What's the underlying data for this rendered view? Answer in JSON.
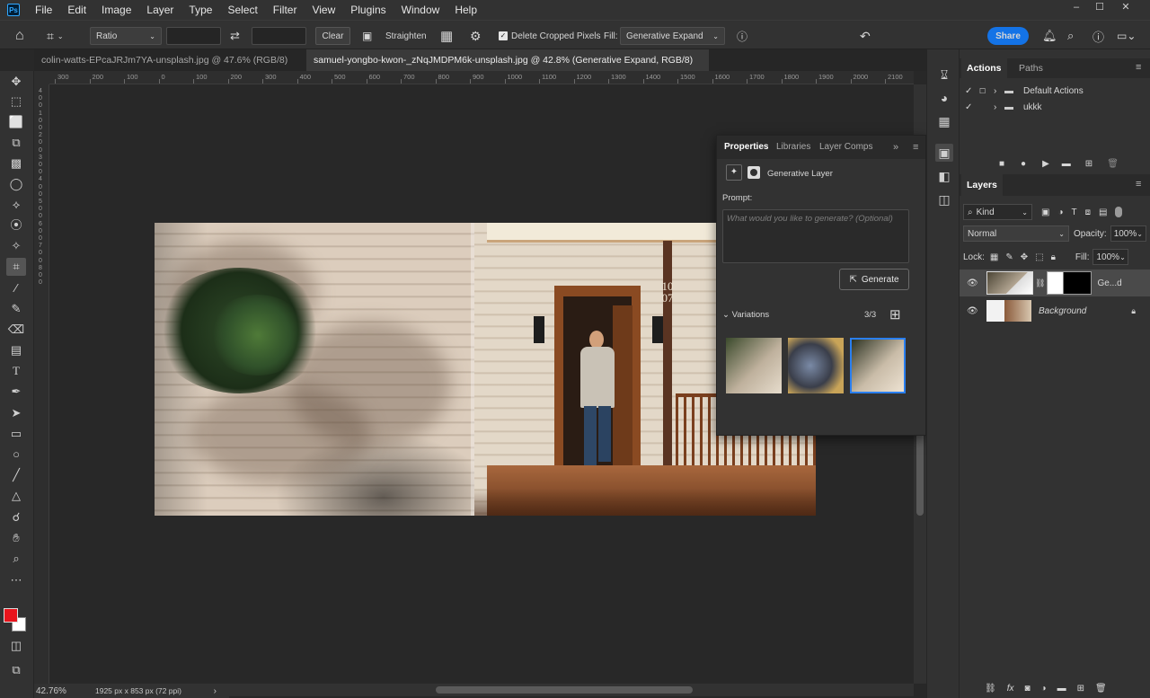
{
  "app": {
    "logo": "Ps"
  },
  "menu": [
    "File",
    "Edit",
    "Image",
    "Layer",
    "Type",
    "Select",
    "Filter",
    "View",
    "Plugins",
    "Window",
    "Help"
  ],
  "window_controls": [
    "‒",
    "☐",
    "✕"
  ],
  "options": {
    "ratio": "Ratio",
    "clear": "Clear",
    "straighten": "Straighten",
    "delete_cropped": "Delete Cropped Pixels",
    "fill_label": "Fill:",
    "fill_value": "Generative Expand",
    "share": "Share"
  },
  "tabs": [
    {
      "label": "colin-watts-EPcaJRJm7YA-unsplash.jpg @ 47.6% (RGB/8) *"
    },
    {
      "label": "samuel-yongbo-kwon-_zNqJMDPM6k-unsplash.jpg @ 42.8% (Generative Expand, RGB/8) *"
    }
  ],
  "ruler_h": [
    "300",
    "200",
    "100",
    "0",
    "100",
    "200",
    "300",
    "400",
    "500",
    "600",
    "700",
    "800",
    "900",
    "1000",
    "1100",
    "1200",
    "1300",
    "1400",
    "1500",
    "1600",
    "1700",
    "1800",
    "1900",
    "2000",
    "2100"
  ],
  "ruler_v": [
    "4",
    "0",
    "0",
    "1",
    "0",
    "0",
    "2",
    "0",
    "0",
    "3",
    "0",
    "0",
    "4",
    "0",
    "0",
    "5",
    "0",
    "0",
    "6",
    "0",
    "0",
    "7",
    "0",
    "0",
    "8",
    "0",
    "0"
  ],
  "status": {
    "zoom": "42.76%",
    "doc_size": "1925 px x 853 px (72 ppi)"
  },
  "photo": {
    "house_number": "1007"
  },
  "properties": {
    "tabs": [
      "Properties",
      "Libraries",
      "Layer Comps"
    ],
    "layer_type": "Generative Layer",
    "prompt_label": "Prompt:",
    "prompt_placeholder": "What would you like to generate? (Optional)",
    "generate": "Generate",
    "variations_label": "Variations",
    "variations_count": "3/3"
  },
  "actions_panel": {
    "tabs": [
      "Actions",
      "Paths"
    ],
    "items": [
      {
        "label": "Default Actions"
      },
      {
        "label": "ukkk"
      }
    ]
  },
  "layers_panel": {
    "title": "Layers",
    "filter": "Kind",
    "blend": "Normal",
    "opacity_label": "Opacity:",
    "opacity": "100%",
    "lock_label": "Lock:",
    "fill_label": "Fill:",
    "fill": "100%",
    "layers": [
      {
        "name": "Ge...d"
      },
      {
        "name": "Background"
      }
    ]
  },
  "colors": {
    "accent": "#1473e6",
    "foreground": "#e8141c",
    "background": "#ffffff"
  }
}
